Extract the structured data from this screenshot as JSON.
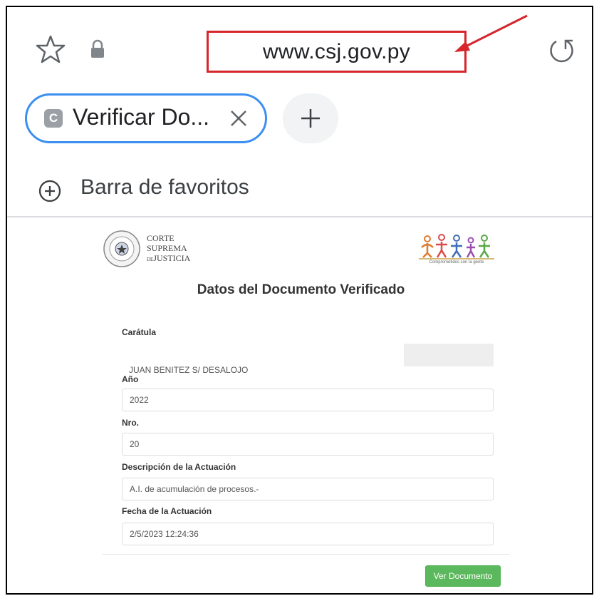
{
  "browser": {
    "url": "www.csj.gov.py",
    "tab": {
      "favicon_letter": "C",
      "title": "Verificar Do..."
    },
    "bookmarks_label": "Barra de favoritos"
  },
  "page": {
    "logo_left": {
      "line1": "CORTE",
      "line2": "SUPREMA",
      "line3_prefix": "DE",
      "line3": "JUSTICIA"
    },
    "logo_right_tagline": "Comprometidos con la gente",
    "title": "Datos del Documento Verificado",
    "fields": [
      {
        "label": "Carátula",
        "value": "JUAN BENITEZ S/ DESALOJO"
      },
      {
        "label": "Año",
        "value": "2022"
      },
      {
        "label": "Nro.",
        "value": "20"
      },
      {
        "label": "Descripción de la Actuación",
        "value": "A.I. de acumulación de procesos.-"
      },
      {
        "label": "Fecha de la Actuación",
        "value": "2/5/2023 12:24:36"
      }
    ],
    "button_label": "Ver Documento"
  },
  "colors": {
    "annotation_red": "#d6252b",
    "tab_outline": "#3b8ff0",
    "button_green": "#5cb85c"
  },
  "icons": [
    "star-icon",
    "lock-icon",
    "reload-icon",
    "close-icon",
    "plus-icon",
    "add-circle-icon",
    "annotation-arrow"
  ]
}
